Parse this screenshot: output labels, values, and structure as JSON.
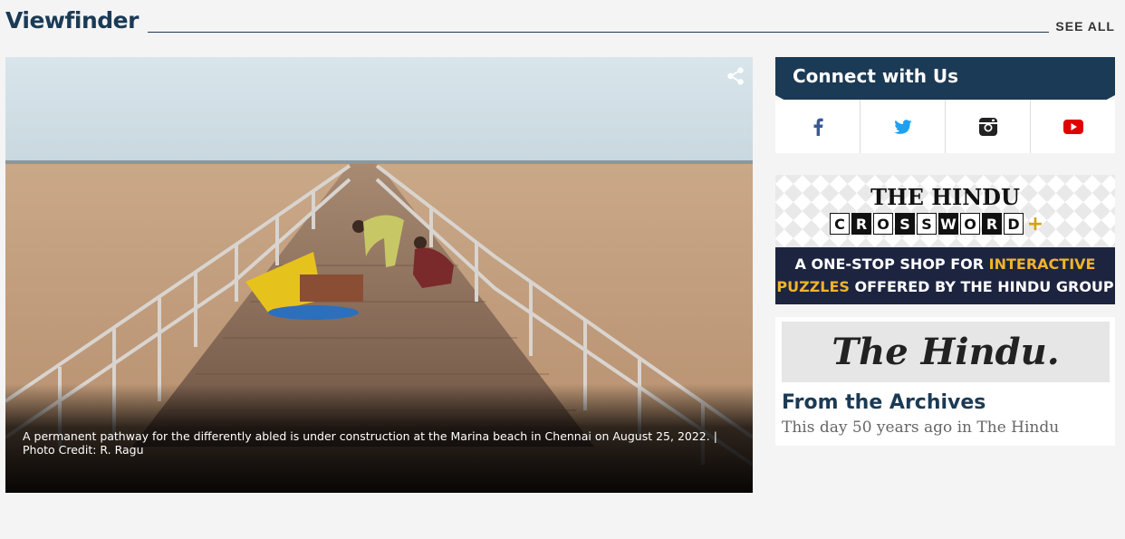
{
  "section": {
    "title": "Viewfinder",
    "see_all": "SEE ALL"
  },
  "photo": {
    "caption": "A permanent pathway for the differently abled is under construction at the Marina beach in Chennai on August 25, 2022. | Photo Credit: R. Ragu",
    "share_icon": "share-icon"
  },
  "connect": {
    "title": "Connect with Us",
    "networks": [
      {
        "name": "facebook",
        "icon": "facebook-icon",
        "color": "#3b5998"
      },
      {
        "name": "twitter",
        "icon": "twitter-icon",
        "color": "#1da1f2"
      },
      {
        "name": "instagram",
        "icon": "instagram-icon",
        "color": "#222222"
      },
      {
        "name": "youtube",
        "icon": "youtube-icon",
        "color": "#e00000"
      }
    ]
  },
  "crossword_ad": {
    "masthead": "THE HINDU",
    "wordmark": [
      "C",
      "R",
      "O",
      "S",
      "S",
      "W",
      "O",
      "R",
      "D"
    ],
    "plus": "+",
    "line1_a": "A ONE-STOP SHOP FOR ",
    "line1_b": "INTERACTIVE",
    "line2_a": "PUZZLES",
    "line2_b": " OFFERED BY THE HINDU GROUP"
  },
  "archives": {
    "masthead": "The Hindu.",
    "title": "From the Archives",
    "subtitle": "This day 50 years ago in The Hindu"
  }
}
